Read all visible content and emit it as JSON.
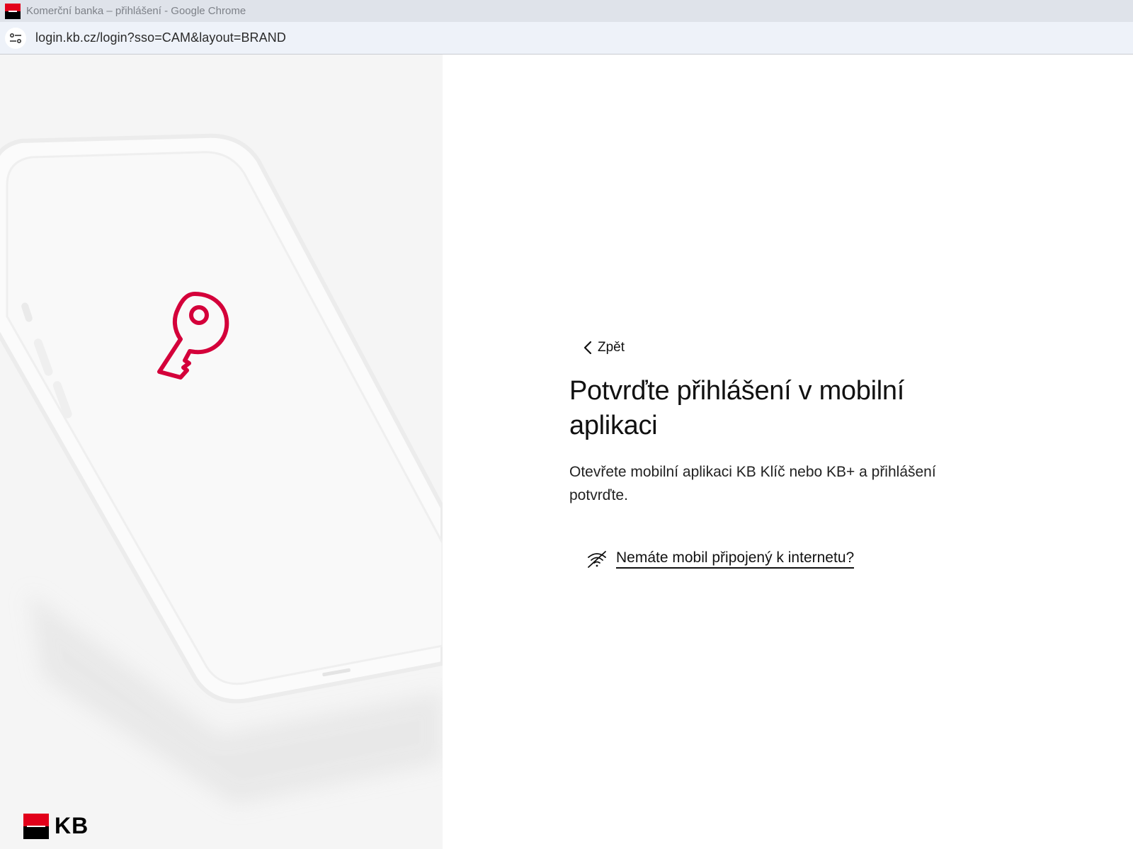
{
  "browser": {
    "window_title": "Komerční banka – přihlášení - Google Chrome",
    "url": "login.kb.cz/login?sso=CAM&layout=BRAND"
  },
  "brand": {
    "logo_text": "KB",
    "accent_color": "#e2001a"
  },
  "login": {
    "back_label": "Zpět",
    "heading": "Potvrďte přihlášení v mobilní aplikaci",
    "description": "Otevřete mobilní aplikaci KB Klíč nebo KB+ a přihlášení potvrďte.",
    "offline_link": "Nemáte mobil připojený k internetu?"
  },
  "icons": {
    "back": "chevron-left-icon",
    "offline": "no-wifi-icon",
    "key": "key-icon",
    "site_info": "tune-icon"
  }
}
